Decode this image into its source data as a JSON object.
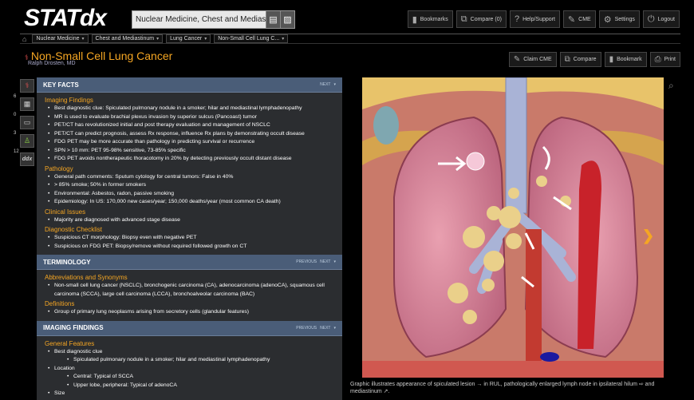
{
  "app": {
    "logo": "STATdx"
  },
  "search": {
    "value": "Nuclear Medicine, Chest and Mediast"
  },
  "topnav": [
    {
      "icon": "bookmark-icon",
      "label": "Bookmarks"
    },
    {
      "icon": "compare-icon",
      "label": "Compare (0)"
    },
    {
      "icon": "help-icon",
      "label": "Help/Support"
    },
    {
      "icon": "cme-icon",
      "label": "CME"
    },
    {
      "icon": "gear-icon",
      "label": "Settings"
    },
    {
      "icon": "power-icon",
      "label": "Logout"
    }
  ],
  "breadcrumb": [
    "Nuclear Medicine",
    "Chest and Mediastinum",
    "Lung Cancer",
    "Non-Small Cell Lung C..."
  ],
  "page": {
    "title": "Non-Small Cell Lung Cancer",
    "author": "Ralph Drosten, MD"
  },
  "actions": [
    {
      "icon": "cme-icon",
      "label": "Claim CME"
    },
    {
      "icon": "compare-icon",
      "label": "Compare"
    },
    {
      "icon": "bookmark-icon",
      "label": "Bookmark"
    },
    {
      "icon": "print-icon",
      "label": "Print"
    }
  ],
  "sidebar": [
    {
      "icon": "dx-icon",
      "count": ""
    },
    {
      "icon": "grid-icon",
      "count": "6"
    },
    {
      "icon": "id-card-icon",
      "count": "0"
    },
    {
      "icon": "person-icon",
      "count": "3"
    },
    {
      "icon": "ddx-icon",
      "count": "12",
      "label": "ddx"
    }
  ],
  "sections": {
    "key_facts": {
      "title": "KEY FACTS",
      "nav": {
        "next": "NEXT"
      },
      "groups": [
        {
          "heading": "Imaging Findings",
          "items": [
            "Best diagnostic clue: Spiculated pulmonary nodule in a smoker; hilar and mediastinal lymphadenopathy",
            "MR is used to evaluate brachial plexus invasion by superior sulcus (Pancoast) tumor",
            "PET/CT has revolutionized initial and post therapy evaluation and management of NSCLC",
            "PET/CT can predict prognosis, assess Rx response, influence Rx plans by demonstrating occult disease",
            "FDG PET may be more accurate than pathology in predicting survival or recurrence",
            "SPN > 10 mm: PET 95-98% sensitive, 73-85% specific",
            "FDG PET avoids nontherapeutic thoracotomy in 20% by detecting previously occult distant disease"
          ]
        },
        {
          "heading": "Pathology",
          "items": [
            "General path comments: Sputum cytology for central tumors: False in 40%",
            "> 85% smoke; 50% in former smokers",
            "Environmental: Asbestos, radon, passive smoking",
            "Epidemiology: In US: 170,000 new cases/year; 150,000 deaths/year (most common CA death)"
          ]
        },
        {
          "heading": "Clinical Issues",
          "items": [
            "Majority are diagnosed with advanced stage disease"
          ]
        },
        {
          "heading": "Diagnostic Checklist",
          "items": [
            "Suspicious CT morphology: Biopsy even with negative PET",
            "Suspicious on FDG PET: Biopsy/remove without required followed growth on CT"
          ]
        }
      ]
    },
    "terminology": {
      "title": "TERMINOLOGY",
      "nav": {
        "prev": "PREVIOUS",
        "next": "NEXT"
      },
      "groups": [
        {
          "heading": "Abbreviations and Synonyms",
          "items": [
            "Non-small cell lung cancer (NSCLC), bronchogenic carcinoma (CA), adenocarcinoma (adenoCA), squamous cell carcinoma (SCCA), large cell carcinoma (LCCA), bronchoalveolar carcinoma (BAC)"
          ]
        },
        {
          "heading": "Definitions",
          "items": [
            "Group of primary lung neoplasms arising from secretory cells (glandular features)"
          ]
        }
      ]
    },
    "imaging_findings": {
      "title": "IMAGING FINDINGS",
      "nav": {
        "prev": "PREVIOUS",
        "next": "NEXT"
      },
      "heading": "General Features",
      "items": [
        {
          "text": "Best diagnostic clue",
          "sub": [
            "Spiculated pulmonary nodule in a smoker; hilar and mediastinal lymphadenopathy"
          ]
        },
        {
          "text": "Location",
          "sub": [
            "Central: Typical of SCCA",
            "Upper lobe, peripheral: Typical of adenoCA"
          ]
        },
        {
          "text": "Size",
          "sub": []
        }
      ]
    }
  },
  "figure": {
    "caption": "Graphic illustrates appearance of spiculated lesion → in RUL, pathologically enlarged lymph node in ipsilateral hilum ⇨ and mediastinum ↗."
  }
}
